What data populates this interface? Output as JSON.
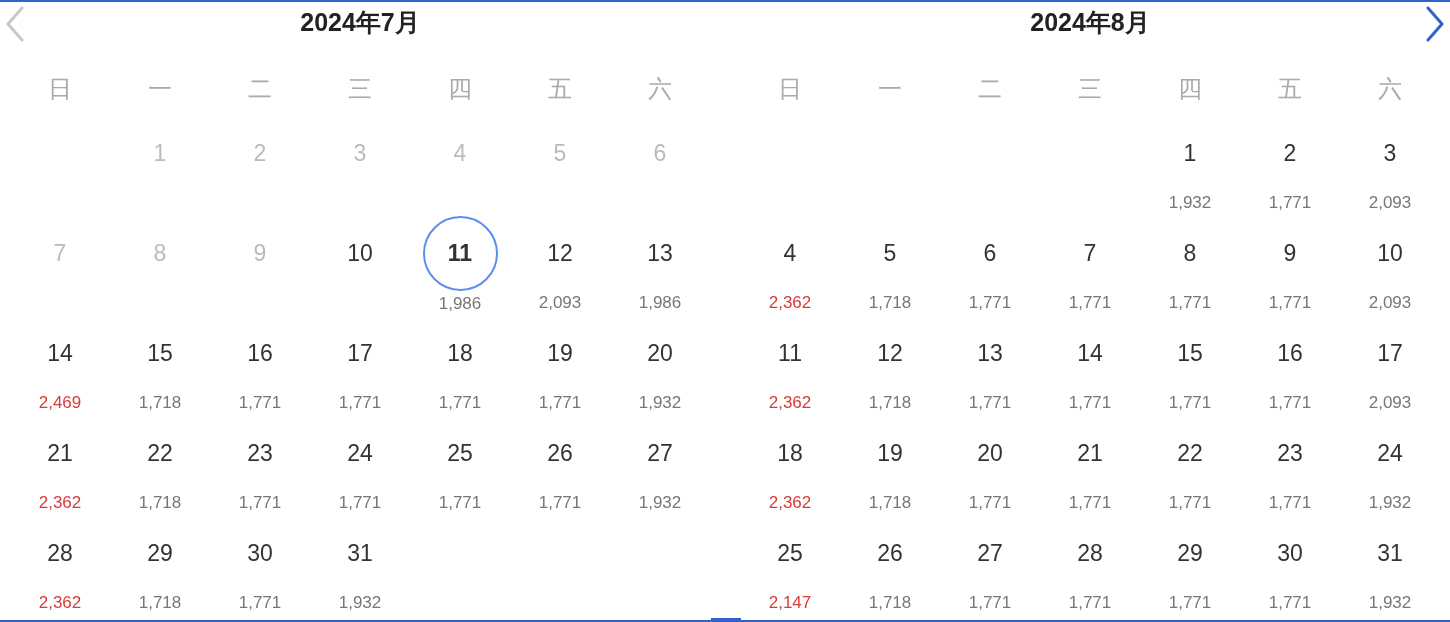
{
  "nav": {
    "prev": {
      "disabled": true
    },
    "next": {
      "disabled": false
    }
  },
  "months": [
    {
      "title": "2024年7月",
      "weekdays": [
        "日",
        "一",
        "二",
        "三",
        "四",
        "五",
        "六"
      ],
      "days": [
        {
          "kind": "blank"
        },
        {
          "kind": "day",
          "day": "1",
          "disabled": true,
          "selected": false
        },
        {
          "kind": "day",
          "day": "2",
          "disabled": true,
          "selected": false
        },
        {
          "kind": "day",
          "day": "3",
          "disabled": true,
          "selected": false
        },
        {
          "kind": "day",
          "day": "4",
          "disabled": true,
          "selected": false
        },
        {
          "kind": "day",
          "day": "5",
          "disabled": true,
          "selected": false
        },
        {
          "kind": "day",
          "day": "6",
          "disabled": true,
          "selected": false
        },
        {
          "kind": "day",
          "day": "7",
          "disabled": true,
          "selected": false
        },
        {
          "kind": "day",
          "day": "8",
          "disabled": true,
          "selected": false
        },
        {
          "kind": "day",
          "day": "9",
          "disabled": true,
          "selected": false
        },
        {
          "kind": "day",
          "day": "10",
          "disabled": false,
          "selected": false
        },
        {
          "kind": "day",
          "day": "11",
          "price": "1,986",
          "disabled": false,
          "selected": true,
          "highlight": false
        },
        {
          "kind": "day",
          "day": "12",
          "price": "2,093",
          "disabled": false,
          "selected": false,
          "highlight": false
        },
        {
          "kind": "day",
          "day": "13",
          "price": "1,986",
          "disabled": false,
          "selected": false,
          "highlight": false
        },
        {
          "kind": "day",
          "day": "14",
          "price": "2,469",
          "disabled": false,
          "selected": false,
          "highlight": true
        },
        {
          "kind": "day",
          "day": "15",
          "price": "1,718",
          "disabled": false,
          "selected": false,
          "highlight": false
        },
        {
          "kind": "day",
          "day": "16",
          "price": "1,771",
          "disabled": false,
          "selected": false,
          "highlight": false
        },
        {
          "kind": "day",
          "day": "17",
          "price": "1,771",
          "disabled": false,
          "selected": false,
          "highlight": false
        },
        {
          "kind": "day",
          "day": "18",
          "price": "1,771",
          "disabled": false,
          "selected": false,
          "highlight": false
        },
        {
          "kind": "day",
          "day": "19",
          "price": "1,771",
          "disabled": false,
          "selected": false,
          "highlight": false
        },
        {
          "kind": "day",
          "day": "20",
          "price": "1,932",
          "disabled": false,
          "selected": false,
          "highlight": false
        },
        {
          "kind": "day",
          "day": "21",
          "price": "2,362",
          "disabled": false,
          "selected": false,
          "highlight": true
        },
        {
          "kind": "day",
          "day": "22",
          "price": "1,718",
          "disabled": false,
          "selected": false,
          "highlight": false
        },
        {
          "kind": "day",
          "day": "23",
          "price": "1,771",
          "disabled": false,
          "selected": false,
          "highlight": false
        },
        {
          "kind": "day",
          "day": "24",
          "price": "1,771",
          "disabled": false,
          "selected": false,
          "highlight": false
        },
        {
          "kind": "day",
          "day": "25",
          "price": "1,771",
          "disabled": false,
          "selected": false,
          "highlight": false
        },
        {
          "kind": "day",
          "day": "26",
          "price": "1,771",
          "disabled": false,
          "selected": false,
          "highlight": false
        },
        {
          "kind": "day",
          "day": "27",
          "price": "1,932",
          "disabled": false,
          "selected": false,
          "highlight": false
        },
        {
          "kind": "day",
          "day": "28",
          "price": "2,362",
          "disabled": false,
          "selected": false,
          "highlight": true
        },
        {
          "kind": "day",
          "day": "29",
          "price": "1,718",
          "disabled": false,
          "selected": false,
          "highlight": false
        },
        {
          "kind": "day",
          "day": "30",
          "price": "1,771",
          "disabled": false,
          "selected": false,
          "highlight": false
        },
        {
          "kind": "day",
          "day": "31",
          "price": "1,932",
          "disabled": false,
          "selected": false,
          "highlight": false
        }
      ]
    },
    {
      "title": "2024年8月",
      "weekdays": [
        "日",
        "一",
        "二",
        "三",
        "四",
        "五",
        "六"
      ],
      "days": [
        {
          "kind": "blank"
        },
        {
          "kind": "blank"
        },
        {
          "kind": "blank"
        },
        {
          "kind": "blank"
        },
        {
          "kind": "day",
          "day": "1",
          "price": "1,932",
          "disabled": false,
          "selected": false,
          "highlight": false
        },
        {
          "kind": "day",
          "day": "2",
          "price": "1,771",
          "disabled": false,
          "selected": false,
          "highlight": false
        },
        {
          "kind": "day",
          "day": "3",
          "price": "2,093",
          "disabled": false,
          "selected": false,
          "highlight": false
        },
        {
          "kind": "day",
          "day": "4",
          "price": "2,362",
          "disabled": false,
          "selected": false,
          "highlight": true
        },
        {
          "kind": "day",
          "day": "5",
          "price": "1,718",
          "disabled": false,
          "selected": false,
          "highlight": false
        },
        {
          "kind": "day",
          "day": "6",
          "price": "1,771",
          "disabled": false,
          "selected": false,
          "highlight": false
        },
        {
          "kind": "day",
          "day": "7",
          "price": "1,771",
          "disabled": false,
          "selected": false,
          "highlight": false
        },
        {
          "kind": "day",
          "day": "8",
          "price": "1,771",
          "disabled": false,
          "selected": false,
          "highlight": false
        },
        {
          "kind": "day",
          "day": "9",
          "price": "1,771",
          "disabled": false,
          "selected": false,
          "highlight": false
        },
        {
          "kind": "day",
          "day": "10",
          "price": "2,093",
          "disabled": false,
          "selected": false,
          "highlight": false
        },
        {
          "kind": "day",
          "day": "11",
          "price": "2,362",
          "disabled": false,
          "selected": false,
          "highlight": true
        },
        {
          "kind": "day",
          "day": "12",
          "price": "1,718",
          "disabled": false,
          "selected": false,
          "highlight": false
        },
        {
          "kind": "day",
          "day": "13",
          "price": "1,771",
          "disabled": false,
          "selected": false,
          "highlight": false
        },
        {
          "kind": "day",
          "day": "14",
          "price": "1,771",
          "disabled": false,
          "selected": false,
          "highlight": false
        },
        {
          "kind": "day",
          "day": "15",
          "price": "1,771",
          "disabled": false,
          "selected": false,
          "highlight": false
        },
        {
          "kind": "day",
          "day": "16",
          "price": "1,771",
          "disabled": false,
          "selected": false,
          "highlight": false
        },
        {
          "kind": "day",
          "day": "17",
          "price": "2,093",
          "disabled": false,
          "selected": false,
          "highlight": false
        },
        {
          "kind": "day",
          "day": "18",
          "price": "2,362",
          "disabled": false,
          "selected": false,
          "highlight": true
        },
        {
          "kind": "day",
          "day": "19",
          "price": "1,718",
          "disabled": false,
          "selected": false,
          "highlight": false
        },
        {
          "kind": "day",
          "day": "20",
          "price": "1,771",
          "disabled": false,
          "selected": false,
          "highlight": false
        },
        {
          "kind": "day",
          "day": "21",
          "price": "1,771",
          "disabled": false,
          "selected": false,
          "highlight": false
        },
        {
          "kind": "day",
          "day": "22",
          "price": "1,771",
          "disabled": false,
          "selected": false,
          "highlight": false
        },
        {
          "kind": "day",
          "day": "23",
          "price": "1,771",
          "disabled": false,
          "selected": false,
          "highlight": false
        },
        {
          "kind": "day",
          "day": "24",
          "price": "1,932",
          "disabled": false,
          "selected": false,
          "highlight": false
        },
        {
          "kind": "day",
          "day": "25",
          "price": "2,147",
          "disabled": false,
          "selected": false,
          "highlight": true
        },
        {
          "kind": "day",
          "day": "26",
          "price": "1,718",
          "disabled": false,
          "selected": false,
          "highlight": false
        },
        {
          "kind": "day",
          "day": "27",
          "price": "1,771",
          "disabled": false,
          "selected": false,
          "highlight": false
        },
        {
          "kind": "day",
          "day": "28",
          "price": "1,771",
          "disabled": false,
          "selected": false,
          "highlight": false
        },
        {
          "kind": "day",
          "day": "29",
          "price": "1,771",
          "disabled": false,
          "selected": false,
          "highlight": false
        },
        {
          "kind": "day",
          "day": "30",
          "price": "1,771",
          "disabled": false,
          "selected": false,
          "highlight": false
        },
        {
          "kind": "day",
          "day": "31",
          "price": "1,932",
          "disabled": false,
          "selected": false,
          "highlight": false
        }
      ]
    }
  ]
}
